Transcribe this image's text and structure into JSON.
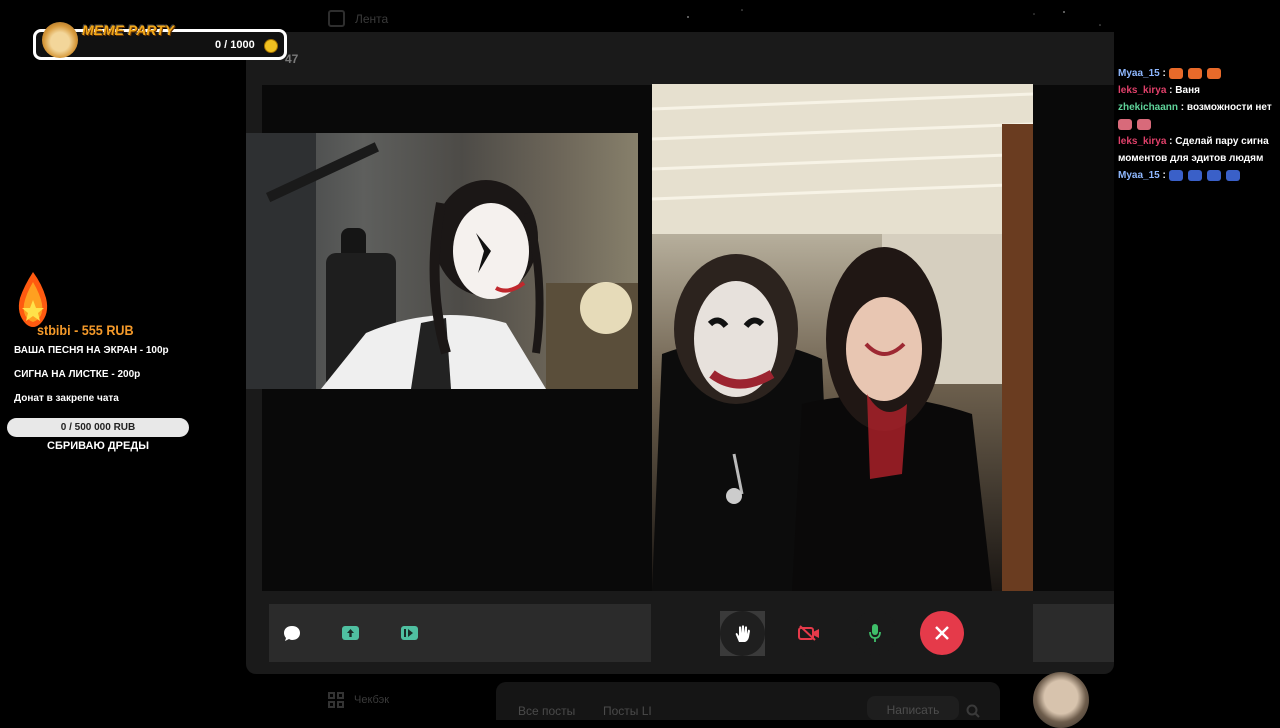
{
  "colors": {
    "accent_red": "#e53a4a",
    "mic_green": "#3fbf6a",
    "donation_orange": "#f59a2a",
    "meme_gold": "#f2a818"
  },
  "background_app": {
    "nav_top_label": "Лента",
    "counter_fragment": "47",
    "nav_bottom_label": "Чекбэк",
    "tabs": [
      "Все посты",
      "Посты LI"
    ],
    "write_button": "Написать",
    "search_icon": "search-icon"
  },
  "meme_party": {
    "title": "MEME PARTY",
    "progress": "0 / 1000",
    "progress_fraction": 0.0
  },
  "donation_panel": {
    "last_donation": "stbibi - 555 RUB",
    "lines": [
      "ВАША ПЕСНЯ НА ЭКРАН - 100р",
      "СИГНА  НА ЛИСТКЕ - 200р",
      "Донат в закрепе чата"
    ],
    "goal_text": "0 / 500 000 RUB",
    "goal_fraction": 0.0,
    "goal_label": "СБРИВАЮ ДРЕДЫ"
  },
  "call_controls": {
    "left_icons": [
      "chat-icon",
      "screen-share-icon",
      "media-icon"
    ],
    "buttons": [
      "hand-raise-icon",
      "camera-off-icon",
      "microphone-icon",
      "end-call-icon"
    ]
  },
  "chat": [
    {
      "user": "Myaa_15",
      "color": "#8fb8ff",
      "text": "",
      "emotes": 3,
      "emote_color": "#e86a2a"
    },
    {
      "user": "leks_kirya",
      "color": "#e0406a",
      "text": "Ваня",
      "emotes": 0
    },
    {
      "user": "zhekichaann",
      "color": "#5fd39a",
      "text": "возможности нет",
      "emotes": 2,
      "emote_color": "#d86a7a"
    },
    {
      "user": "leks_kirya",
      "color": "#e0406a",
      "text": "Сделай пару сигна моментов для эдитов людям",
      "emotes": 0
    },
    {
      "user": "Myaa_15",
      "color": "#8fb8ff",
      "text": "",
      "emotes": 4,
      "emote_color": "#3a60c8"
    }
  ]
}
